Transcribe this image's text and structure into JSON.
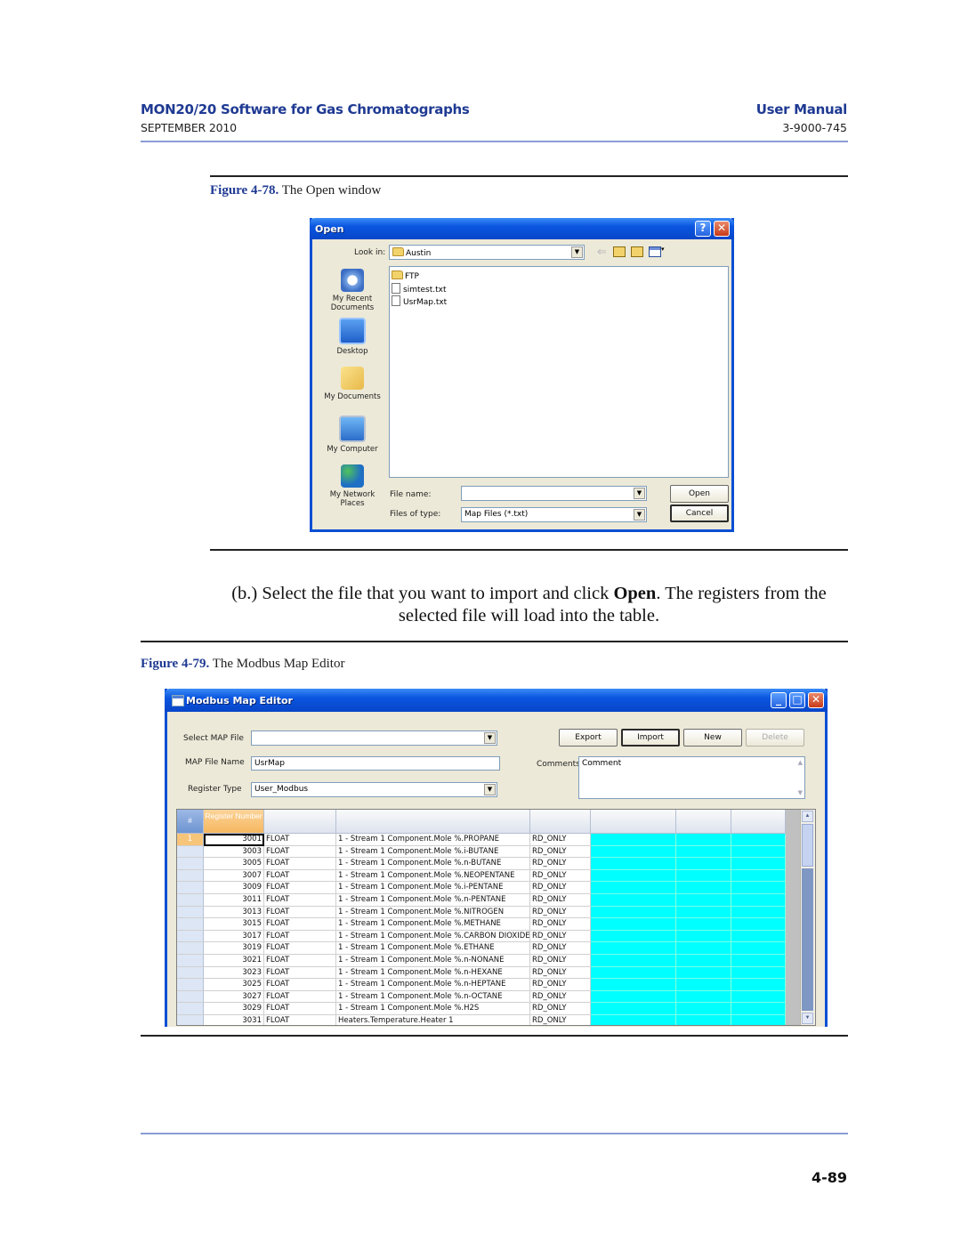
{
  "header": {
    "title": "MON20/20 Software for Gas Chromatographs",
    "date": "SEPTEMBER 2010",
    "manual": "User Manual",
    "doc_number": "3-9000-745"
  },
  "figure78": {
    "label": "Figure 4-78.",
    "caption": "The Open window"
  },
  "open_dialog": {
    "title": "Open",
    "help_button": "?",
    "close_button": "✕",
    "look_in_label": "Look in:",
    "look_in_value": "Austin",
    "places": [
      "My Recent Documents",
      "Desktop",
      "My Documents",
      "My Computer",
      "My Network Places"
    ],
    "files": [
      {
        "name": "FTP",
        "type": "folder"
      },
      {
        "name": "simtest.txt",
        "type": "file"
      },
      {
        "name": "UsrMap.txt",
        "type": "file"
      }
    ],
    "file_name_label": "File name:",
    "file_name_value": "",
    "file_type_label": "Files of type:",
    "file_type_value": "Map Files (*.txt)",
    "open_button": "Open",
    "cancel_button": "Cancel"
  },
  "instruction": {
    "prefix": "(b.) Select the file that you want to import and click ",
    "bold": "Open",
    "suffix": ".  The registers from the selected file will load into the table."
  },
  "figure79": {
    "label": "Figure 4-79.",
    "caption": "The Modbus Map Editor"
  },
  "modbus_editor": {
    "title": "Modbus Map Editor",
    "select_map_label": "Select MAP File",
    "select_map_value": "",
    "map_name_label": "MAP File Name",
    "map_name_value": "UsrMap",
    "register_type_label": "Register Type",
    "register_type_value": "User_Modbus",
    "comments_label": "Comments",
    "comments_value": "Comment",
    "buttons": {
      "export": "Export",
      "import": "Import",
      "new": "New",
      "delete": "Delete"
    },
    "grid": {
      "corner": "#",
      "headers": [
        "Register Number",
        "",
        "",
        "",
        "",
        "",
        ""
      ],
      "selected_row": "1",
      "rows": [
        {
          "reg": "3001",
          "type": "FLOAT",
          "desc": "1 - Stream 1 Component.Mole %.PROPANE",
          "access": "RD_ONLY"
        },
        {
          "reg": "3003",
          "type": "FLOAT",
          "desc": "1 - Stream 1 Component.Mole %.i-BUTANE",
          "access": "RD_ONLY"
        },
        {
          "reg": "3005",
          "type": "FLOAT",
          "desc": "1 - Stream 1 Component.Mole %.n-BUTANE",
          "access": "RD_ONLY"
        },
        {
          "reg": "3007",
          "type": "FLOAT",
          "desc": "1 - Stream 1 Component.Mole %.NEOPENTANE",
          "access": "RD_ONLY"
        },
        {
          "reg": "3009",
          "type": "FLOAT",
          "desc": "1 - Stream 1 Component.Mole %.i-PENTANE",
          "access": "RD_ONLY"
        },
        {
          "reg": "3011",
          "type": "FLOAT",
          "desc": "1 - Stream 1 Component.Mole %.n-PENTANE",
          "access": "RD_ONLY"
        },
        {
          "reg": "3013",
          "type": "FLOAT",
          "desc": "1 - Stream 1 Component.Mole %.NITROGEN",
          "access": "RD_ONLY"
        },
        {
          "reg": "3015",
          "type": "FLOAT",
          "desc": "1 - Stream 1 Component.Mole %.METHANE",
          "access": "RD_ONLY"
        },
        {
          "reg": "3017",
          "type": "FLOAT",
          "desc": "1 - Stream 1 Component.Mole %.CARBON DIOXIDE",
          "access": "RD_ONLY"
        },
        {
          "reg": "3019",
          "type": "FLOAT",
          "desc": "1 - Stream 1 Component.Mole %.ETHANE",
          "access": "RD_ONLY"
        },
        {
          "reg": "3021",
          "type": "FLOAT",
          "desc": "1 - Stream 1 Component.Mole %.n-NONANE",
          "access": "RD_ONLY"
        },
        {
          "reg": "3023",
          "type": "FLOAT",
          "desc": "1 - Stream 1 Component.Mole %.n-HEXANE",
          "access": "RD_ONLY"
        },
        {
          "reg": "3025",
          "type": "FLOAT",
          "desc": "1 - Stream 1 Component.Mole %.n-HEPTANE",
          "access": "RD_ONLY"
        },
        {
          "reg": "3027",
          "type": "FLOAT",
          "desc": "1 - Stream 1 Component.Mole %.n-OCTANE",
          "access": "RD_ONLY"
        },
        {
          "reg": "3029",
          "type": "FLOAT",
          "desc": "1 - Stream 1 Component.Mole %.H2S",
          "access": "RD_ONLY"
        },
        {
          "reg": "3031",
          "type": "FLOAT",
          "desc": "Heaters.Temperature.Heater 1",
          "access": "RD_ONLY"
        }
      ]
    }
  },
  "footer": {
    "page_number": "4-89"
  },
  "colors": {
    "brand_blue": "#1f3a93",
    "rule_blue": "#8c9bd6",
    "cell_cyan": "#00ffff"
  }
}
